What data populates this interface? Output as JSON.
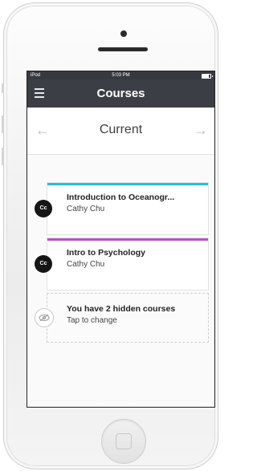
{
  "status_bar": {
    "carrier": "iPod",
    "time": "5:03 PM",
    "battery_level": 0.8
  },
  "nav": {
    "title": "Courses",
    "menu_icon": "hamburger-menu-icon"
  },
  "term": {
    "label": "Current",
    "prev_icon": "arrow-left-icon",
    "next_icon": "arrow-right-icon"
  },
  "courses": [
    {
      "title": "Introduction to Oceanogr...",
      "instructor": "Cathy Chu",
      "avatar_text": "Cc",
      "accent_color": "#19c3d7"
    },
    {
      "title": "Intro to Psychology",
      "instructor": "Cathy Chu",
      "avatar_text": "Cc",
      "accent_color": "#b84fcb"
    }
  ],
  "hidden_courses": {
    "title": "You have 2 hidden courses",
    "subtitle": "Tap to change",
    "icon": "eye-slash-icon"
  },
  "colors": {
    "navbar": "#3b3f45",
    "statusbar": "#363a40"
  }
}
